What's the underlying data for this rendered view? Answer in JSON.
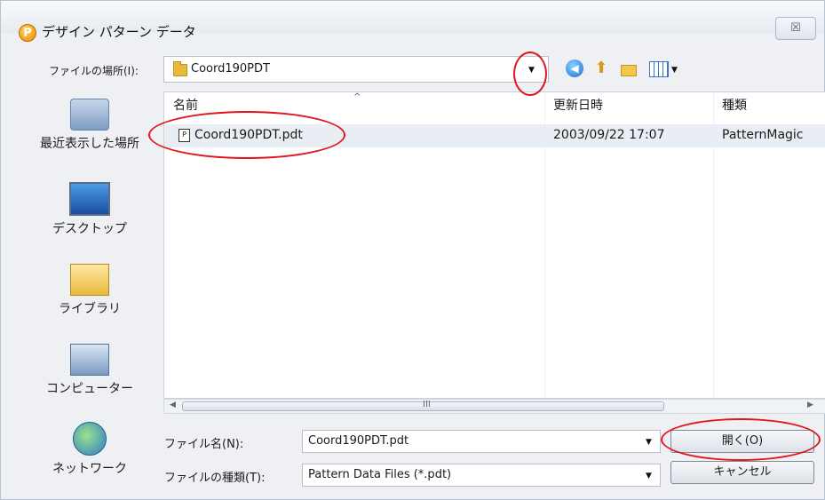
{
  "window": {
    "title": "デザイン パターン データ",
    "app_icon_letter": "P",
    "close_symbol": "☒"
  },
  "toolbar": {
    "look_in_label": "ファイルの場所(I):",
    "look_in_value": "Coord190PDT",
    "icons": [
      "back-icon",
      "up-folder-icon",
      "new-folder-icon",
      "views-menu-icon"
    ]
  },
  "places": [
    {
      "label": "最近表示した場所",
      "icon": "recent-places-icon"
    },
    {
      "label": "デスクトップ",
      "icon": "desktop-icon"
    },
    {
      "label": "ライブラリ",
      "icon": "libraries-icon"
    },
    {
      "label": "コンピューター",
      "icon": "computer-icon"
    },
    {
      "label": "ネットワーク",
      "icon": "network-icon"
    }
  ],
  "file_list": {
    "columns": [
      "名前",
      "更新日時",
      "種類"
    ],
    "rows": [
      {
        "name": "Coord190PDT.pdt",
        "modified": "2003/09/22 17:07",
        "type": "PatternMagic"
      }
    ]
  },
  "scrollbar": {
    "grip": "III"
  },
  "bottom": {
    "filename_label": "ファイル名(N):",
    "filename_value": "Coord190PDT.pdt",
    "filetype_label": "ファイルの種類(T):",
    "filetype_value": "Pattern Data Files (*.pdt)",
    "open_button": "開く(O)",
    "cancel_button": "キャンセル"
  },
  "annotation_color": "#e0161d"
}
